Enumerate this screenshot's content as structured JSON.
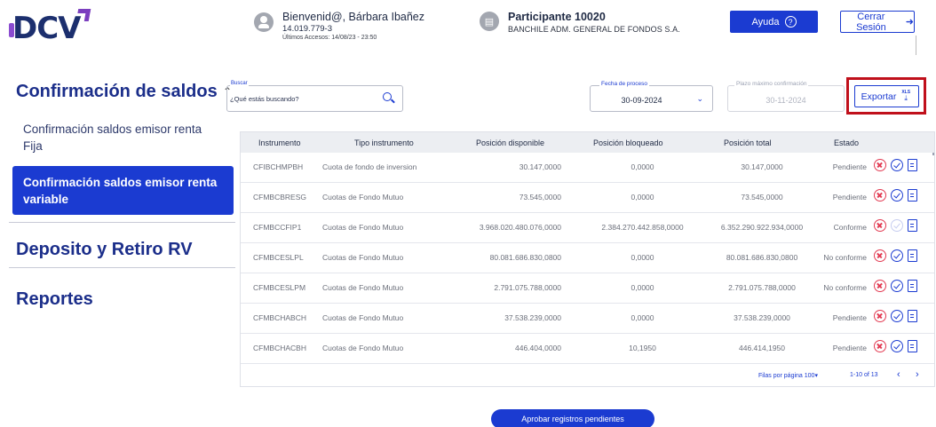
{
  "header": {
    "logo": "DCV",
    "greeting": "Bienvenid@, Bárbara Ibañez",
    "rut": "14.019.779-3",
    "last_access": "Últimos Accesos: 14/08/23 - 23:50",
    "participant_title": "Participante 10020",
    "participant_name": "BANCHILE ADM. GENERAL DE FONDOS S.A.",
    "help_label": "Ayuda",
    "logout_label": "Cerrar Sesión"
  },
  "sidebar": {
    "section_title": "Confirmación de saldos",
    "items": [
      {
        "label": "Confirmación saldos emisor renta Fija"
      },
      {
        "label": "Confirmación saldos emisor renta variable"
      }
    ],
    "deposito_label": "Deposito y Retiro RV",
    "reportes_label": "Reportes"
  },
  "filters": {
    "search_label": "Buscar",
    "search_placeholder": "¿Qué estás buscando?",
    "date_label": "Fecha de proceso",
    "date_value": "30-09-2024",
    "plazo_label": "Plazo máximo confirmación",
    "plazo_value": "30-11-2024",
    "export_label": "Exportar",
    "export_icon_text": "XLS"
  },
  "table": {
    "headers": [
      "Instrumento",
      "Tipo instrumento",
      "Posición disponible",
      "Posición bloqueado",
      "Posición total",
      "Estado"
    ],
    "rows": [
      [
        "CFIBCHMPBH",
        "Cuota de fondo de inversion",
        "30.147,0000",
        "0,0000",
        "30.147,0000",
        "Pendiente"
      ],
      [
        "CFMBCBRESG",
        "Cuotas de Fondo Mutuo",
        "73.545,0000",
        "0,0000",
        "73.545,0000",
        "Pendiente"
      ],
      [
        "CFMBCCFIP1",
        "Cuotas de Fondo Mutuo",
        "3.968.020.480.076,0000",
        "2.384.270.442.858,0000",
        "6.352.290.922.934,0000",
        "Conforme"
      ],
      [
        "CFMBCESLPL",
        "Cuotas de Fondo Mutuo",
        "80.081.686.830,0800",
        "0,0000",
        "80.081.686.830,0800",
        "No conforme"
      ],
      [
        "CFMBCESLPM",
        "Cuotas de Fondo Mutuo",
        "2.791.075.788,0000",
        "0,0000",
        "2.791.075.788,0000",
        "No conforme"
      ],
      [
        "CFMBCHABCH",
        "Cuotas de Fondo Mutuo",
        "37.538.239,0000",
        "0,0000",
        "37.538.239,0000",
        "Pendiente"
      ],
      [
        "CFMBCHACBH",
        "Cuotas de Fondo Mutuo",
        "446.404,0000",
        "10,1950",
        "446.414,1950",
        "Pendiente"
      ]
    ],
    "rows_per_page_label": "Filas por página",
    "rows_per_page_value": "100",
    "range": "1-10 of 13"
  },
  "approve_label": "Aprobar registros pendientes",
  "colors": {
    "primary": "#1b3bd1",
    "danger": "#e23a52",
    "highlight": "#c0101b",
    "heading": "#1b2e8a"
  }
}
